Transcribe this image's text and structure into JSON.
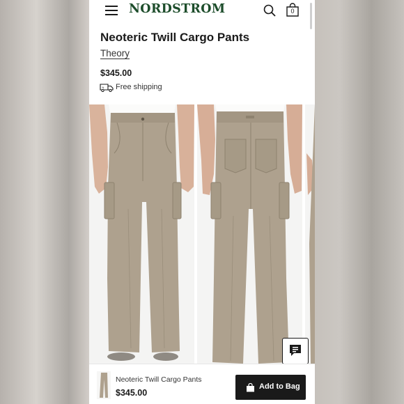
{
  "header": {
    "logo": "NORDSTROM",
    "bag_count": "0",
    "menu_icon": "hamburger-menu-icon",
    "search_icon": "search-icon",
    "bag_icon": "shopping-bag-icon"
  },
  "product": {
    "title": "Neoteric Twill Cargo Pants",
    "brand": "Theory",
    "price": "$345.00",
    "shipping": "Free shipping",
    "shipping_icon": "delivery-truck-icon"
  },
  "gallery": {
    "images": [
      "front-view",
      "back-view",
      "side-view"
    ]
  },
  "chat": {
    "icon": "chat-bubble-icon"
  },
  "sticky_bar": {
    "name": "Neoteric Twill Cargo Pants",
    "price": "$345.00",
    "button_label": "Add to Bag",
    "button_icon": "shopping-bag-icon"
  },
  "colors": {
    "brand_green": "#1d4d2b",
    "button_dark": "#1a1a1a",
    "pants_khaki": "#aea18e"
  }
}
